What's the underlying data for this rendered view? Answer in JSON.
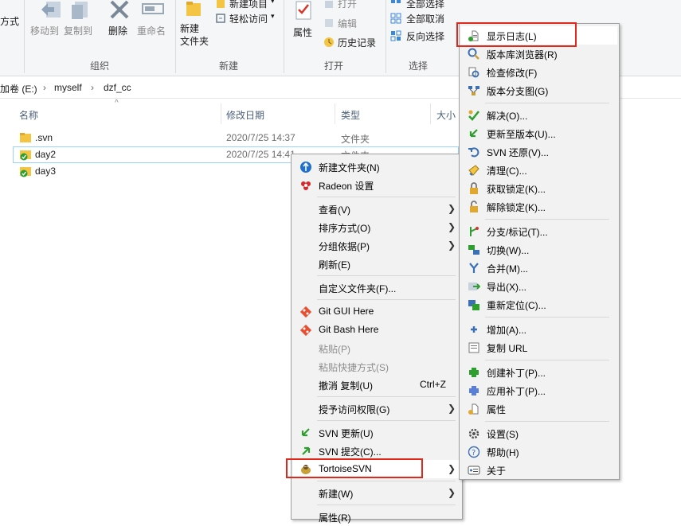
{
  "ribbon": {
    "far_left_partial": "方式",
    "organize": {
      "move_to": "移动到",
      "copy_to": "复制到",
      "delete": "删除",
      "rename": "重命名",
      "title": "组织"
    },
    "new": {
      "new_folder": "新建\n文件夹",
      "new_item": "新建项目",
      "easy_access": "轻松访问",
      "title": "新建"
    },
    "open": {
      "properties": "属性",
      "open": "打开",
      "edit": "编辑",
      "history": "历史记录",
      "title": "打开"
    },
    "select": {
      "select_all": "全部选择",
      "select_none": "全部取消",
      "invert": "反向选择",
      "title": "选择"
    }
  },
  "address": {
    "drive": "加卷 (E:)",
    "seg1": "myself",
    "seg2": "dzf_cc",
    "sep": "›"
  },
  "columns": {
    "name": "名称",
    "date": "修改日期",
    "type": "类型",
    "size": "大小"
  },
  "files": [
    {
      "name": ".svn",
      "date": "2020/7/25 14:37",
      "type": "文件夹"
    },
    {
      "name": "day2",
      "date": "2020/7/25 14:41",
      "type": "文件夹"
    },
    {
      "name": "day3",
      "date": "",
      "type": ""
    }
  ],
  "context_menu": {
    "items": [
      {
        "label": "新建文件夹(N)",
        "icon": "new-folder-icon"
      },
      {
        "label": "Radeon 设置",
        "icon": "radeon-icon"
      },
      {
        "label": "查看(V)"
      },
      {
        "label": "排序方式(O)"
      },
      {
        "label": "分组依据(P)"
      },
      {
        "label": "刷新(E)"
      },
      {
        "label": "自定义文件夹(F)..."
      },
      {
        "label": "Git GUI Here",
        "icon": "git-icon"
      },
      {
        "label": "Git Bash Here",
        "icon": "git-icon"
      },
      {
        "label": "粘贴(P)"
      },
      {
        "label": "粘贴快捷方式(S)"
      },
      {
        "label": "撤消 复制(U)",
        "shortcut": "Ctrl+Z"
      },
      {
        "label": "授予访问权限(G)"
      },
      {
        "label": "SVN 更新(U)",
        "icon": "svn-update-icon"
      },
      {
        "label": "SVN 提交(C)...",
        "icon": "svn-commit-icon"
      },
      {
        "label": "TortoiseSVN",
        "icon": "tortoise-icon"
      },
      {
        "label": "新建(W)"
      },
      {
        "label": "属性(R)"
      }
    ]
  },
  "svn_menu": {
    "items": [
      {
        "label": "显示日志(L)"
      },
      {
        "label": "版本库浏览器(R)"
      },
      {
        "label": "检查修改(F)"
      },
      {
        "label": "版本分支图(G)"
      },
      {
        "label": "解决(O)..."
      },
      {
        "label": "更新至版本(U)..."
      },
      {
        "label": "SVN 还原(V)..."
      },
      {
        "label": "清理(C)..."
      },
      {
        "label": "获取锁定(K)..."
      },
      {
        "label": "解除锁定(K)..."
      },
      {
        "label": "分支/标记(T)..."
      },
      {
        "label": "切换(W)..."
      },
      {
        "label": "合并(M)..."
      },
      {
        "label": "导出(X)..."
      },
      {
        "label": "重新定位(C)..."
      },
      {
        "label": "增加(A)..."
      },
      {
        "label": "复制 URL"
      },
      {
        "label": "创建补丁(P)..."
      },
      {
        "label": "应用补丁(P)..."
      },
      {
        "label": "属性"
      },
      {
        "label": "设置(S)"
      },
      {
        "label": "帮助(H)"
      },
      {
        "label": "关于"
      }
    ]
  },
  "colors": {
    "highlight_box": "#e0281d",
    "selection_border": "#99d1ff",
    "svn_green": "#2e9e2e",
    "folder_yellow": "#f4c542"
  }
}
